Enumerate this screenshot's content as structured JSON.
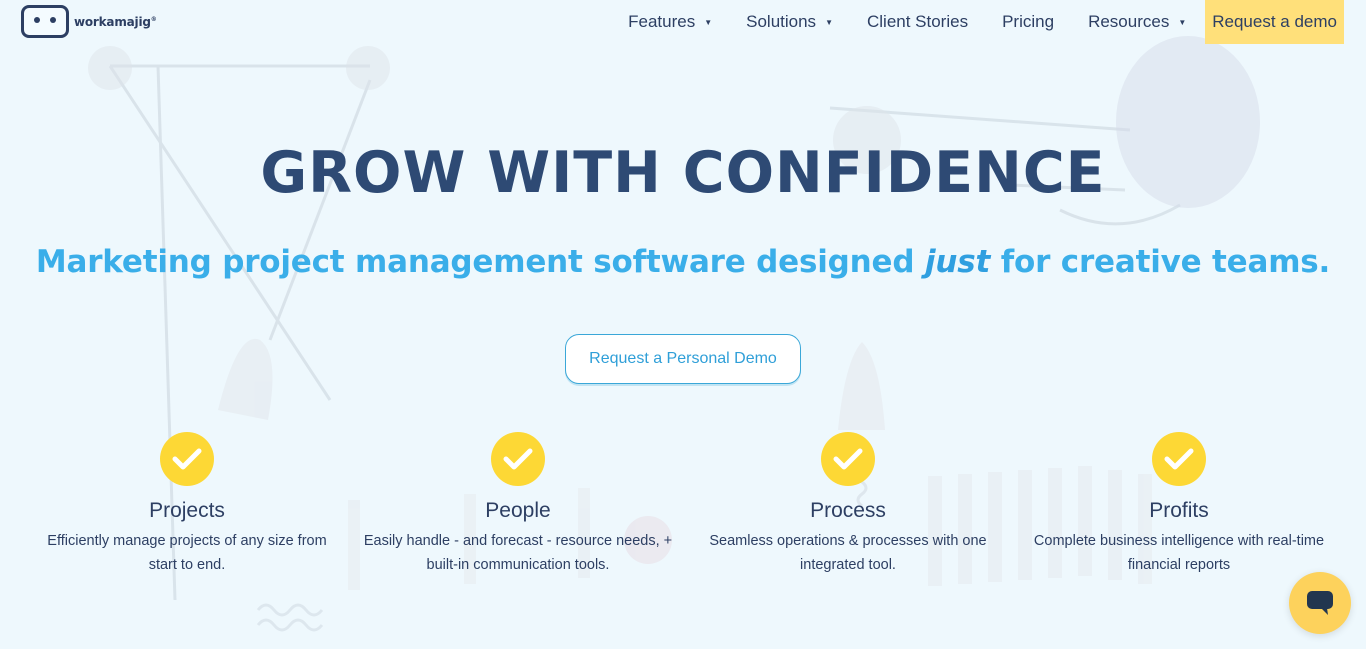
{
  "brand": {
    "name": "workamajig",
    "trademark": "®",
    "logo_icon": "robot-face-icon",
    "colors": {
      "navy": "#2d3f63",
      "title": "#2e4a74",
      "accent_blue": "#3aaee9",
      "yellow": "#fdd835",
      "cta_yellow": "#ffe07a",
      "background": "#eef8fd"
    }
  },
  "nav": {
    "items": [
      {
        "label": "Features",
        "has_dropdown": true
      },
      {
        "label": "Solutions",
        "has_dropdown": true
      },
      {
        "label": "Client Stories",
        "has_dropdown": false
      },
      {
        "label": "Pricing",
        "has_dropdown": false
      },
      {
        "label": "Resources",
        "has_dropdown": true
      }
    ],
    "cta_label": "Request a demo"
  },
  "hero": {
    "title": "GROW WITH CONFIDENCE",
    "subtitle_before": "Marketing project management software designed ",
    "subtitle_emphasis": "just",
    "subtitle_after": " for creative teams.",
    "button_label": "Request a Personal Demo"
  },
  "features": [
    {
      "icon": "checkmark-icon",
      "title": "Projects",
      "description": "Efficiently manage projects of any size from start to end."
    },
    {
      "icon": "checkmark-icon",
      "title": "People",
      "description": "Easily handle - and forecast - resource needs, + built-in communication tools."
    },
    {
      "icon": "checkmark-icon",
      "title": "Process",
      "description": "Seamless operations & processes with one integrated tool."
    },
    {
      "icon": "checkmark-icon",
      "title": "Profits",
      "description": "Complete business intelligence with real-time financial reports"
    }
  ],
  "chat": {
    "icon": "chat-bubble-icon"
  }
}
